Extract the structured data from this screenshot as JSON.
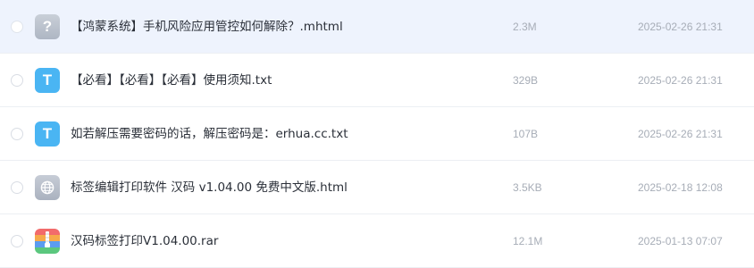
{
  "files": [
    {
      "name": "【鸿蒙系统】手机风险应用管控如何解除？.mhtml",
      "size": "2.3M",
      "date": "2025-02-26 21:31",
      "icon": "unknown-file-icon",
      "icon_glyph": "?",
      "selected": true
    },
    {
      "name": "【必看】【必看】【必看】使用须知.txt",
      "size": "329B",
      "date": "2025-02-26 21:31",
      "icon": "text-file-icon",
      "icon_glyph": "T",
      "selected": false
    },
    {
      "name": "如若解压需要密码的话，解压密码是：erhua.cc.txt",
      "size": "107B",
      "date": "2025-02-26 21:31",
      "icon": "text-file-icon",
      "icon_glyph": "T",
      "selected": false
    },
    {
      "name": "标签编辑打印软件 汉码 v1.04.00 免费中文版.html",
      "size": "3.5KB",
      "date": "2025-02-18 12:08",
      "icon": "web-file-icon",
      "selected": false
    },
    {
      "name": "汉码标签打印V1.04.00.rar",
      "size": "12.1M",
      "date": "2025-01-13 07:07",
      "icon": "archive-file-icon",
      "selected": false
    }
  ],
  "colors": {
    "selected_row_bg": "#eef3fd",
    "text_primary": "#2a2f38",
    "text_secondary": "#a7adb7",
    "txt_icon_blue": "#4ab5f3",
    "divider": "#eceff3"
  }
}
